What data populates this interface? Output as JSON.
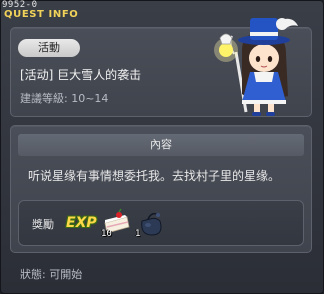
{
  "window": {
    "id": "9952-0",
    "title": "QUEST INFO"
  },
  "quest": {
    "category": "活動",
    "name": "[活动] 巨大雪人的袭击",
    "recommended_level": "建議等級: 10~14"
  },
  "content": {
    "header": "內容",
    "description": "听说星缘有事情想委托我。去找村子里的星缘。"
  },
  "rewards": {
    "label": "獎勵",
    "exp_label": "EXP",
    "items": [
      {
        "icon": "cake-icon",
        "quantity": "10"
      },
      {
        "icon": "pouch-icon",
        "quantity": "1"
      }
    ]
  },
  "status": "狀態: 可開始",
  "colors": {
    "title": "#f2d35a",
    "panel": "#464a53",
    "background": "#2b2e36"
  }
}
